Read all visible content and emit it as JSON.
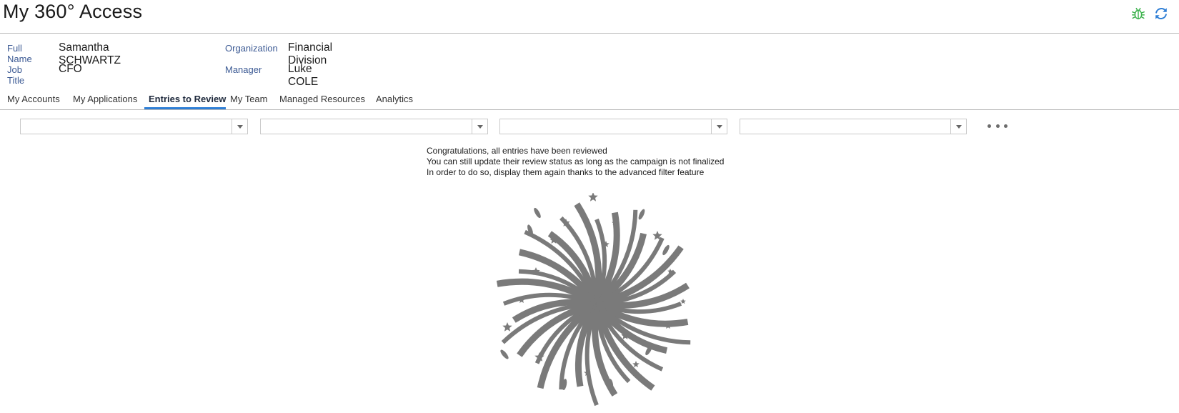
{
  "page": {
    "title": "My 360° Access"
  },
  "header_icons": [
    {
      "name": "bug-icon",
      "color": "#3fb34f"
    },
    {
      "name": "refresh-icon",
      "color": "#2f7fd6"
    }
  ],
  "profile": {
    "full_name_label": "Full Name",
    "full_name_value": "Samantha SCHWARTZ",
    "job_title_label": "Job Title",
    "job_title_value": "CFO",
    "organization_label": "Organization",
    "organization_value": "Financial Division",
    "manager_label": "Manager",
    "manager_value": "Luke COLE"
  },
  "tabs": [
    {
      "label": "My Accounts",
      "active": false
    },
    {
      "label": "My Applications",
      "active": false
    },
    {
      "label": "Entries to Review",
      "active": true
    },
    {
      "label": "My Team",
      "active": false
    },
    {
      "label": "Managed Resources",
      "active": false
    },
    {
      "label": "Analytics",
      "active": false
    }
  ],
  "filters": [
    {
      "value": ""
    },
    {
      "value": ""
    },
    {
      "value": ""
    },
    {
      "value": ""
    }
  ],
  "message": {
    "line1": "Congratulations, all entries have been reviewed",
    "line2": "You can still update their review status as long as the campaign is not finalized",
    "line3": "In order to do so, display them again thanks to the advanced filter feature"
  },
  "illustration": {
    "name": "fireworks-icon",
    "color": "#7a7a7a"
  },
  "colors": {
    "accent": "#2f7fd6",
    "label": "#3c5a94",
    "divider": "#b9b9b9"
  }
}
